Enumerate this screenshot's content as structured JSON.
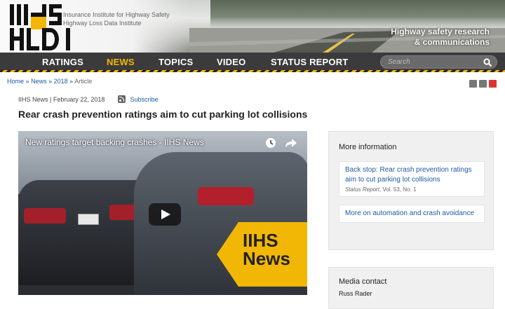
{
  "header": {
    "logo_text": "IIHS HLDI",
    "tagline": [
      "Insurance Institute for Highway Safety",
      "Highway Loss Data Institute"
    ],
    "slogan": [
      "Highway safety research",
      "& communications"
    ]
  },
  "nav": {
    "items": [
      {
        "label": "RATINGS",
        "active": false
      },
      {
        "label": "NEWS",
        "active": true
      },
      {
        "label": "TOPICS",
        "active": false
      },
      {
        "label": "VIDEO",
        "active": false
      },
      {
        "label": "STATUS REPORT",
        "active": false
      }
    ],
    "search_placeholder": "Search"
  },
  "breadcrumb": {
    "items": [
      "Home",
      "News",
      "2018"
    ],
    "current": "Article",
    "separator": "»"
  },
  "article": {
    "meta": "IIHS News | February 22, 2018",
    "subscribe": "Subscribe",
    "title": "Rear crash prevention ratings aim to cut parking lot collisions"
  },
  "video": {
    "title": "New ratings target backing crashes - IIHS News",
    "badge": [
      "IIHS",
      "News"
    ]
  },
  "sidebar": {
    "heading": "More information",
    "links": [
      {
        "title": "Back stop: Rear crash prevention ratings aim to cut parking lot collisions",
        "source": "Status Report",
        "detail": ", Vol. 53, No. 1"
      },
      {
        "title": "More on automation and crash avoidance"
      }
    ]
  },
  "media_contact": {
    "heading": "Media contact",
    "name": "Russ Rader"
  },
  "colors": {
    "accent": "#f2b705",
    "link": "#1c5aa6",
    "nav_bg": "#3b3b3b"
  }
}
